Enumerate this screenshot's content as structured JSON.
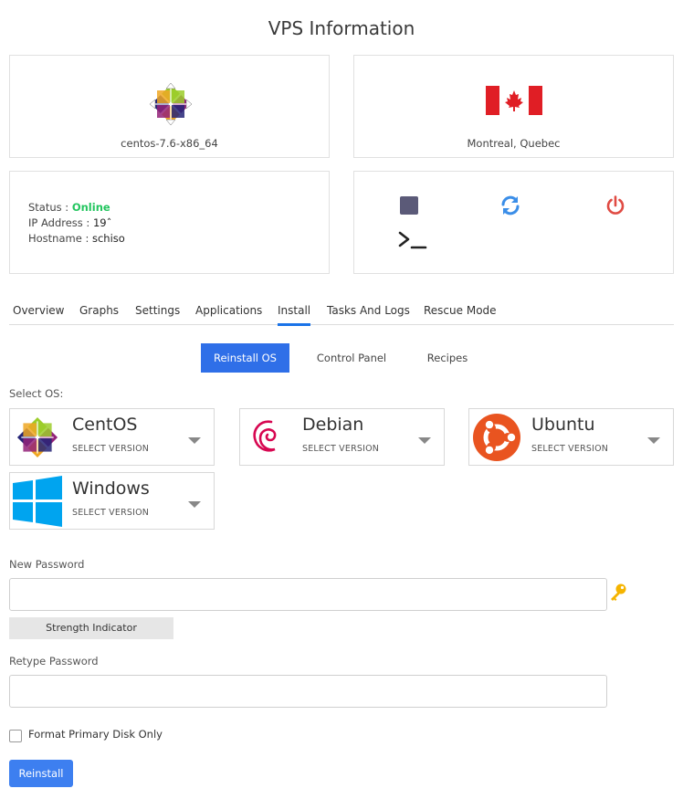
{
  "page": {
    "title": "VPS Information"
  },
  "os_card": {
    "name": "centos-7.6-x86_64",
    "logo": "centos-logo-icon"
  },
  "location_card": {
    "name": "Montreal, Quebec",
    "flag": "canada-flag-icon"
  },
  "info_card": {
    "status_label": "Status : ",
    "status_value": "Online",
    "ip_label": "IP Address : ",
    "ip_value": "19ˆ",
    "hostname_label": "Hostname : ",
    "hostname_value": "schiso"
  },
  "controls": [
    {
      "name": "stop-icon"
    },
    {
      "name": "restart-icon"
    },
    {
      "name": "power-icon"
    },
    {
      "name": "console-icon"
    }
  ],
  "tabs": [
    "Overview",
    "Graphs",
    "Settings",
    "Applications",
    "Install",
    "Tasks And Logs",
    "Rescue Mode"
  ],
  "active_tab": "Install",
  "subtabs": [
    "Reinstall OS",
    "Control Panel",
    "Recipes"
  ],
  "active_subtab": "Reinstall OS",
  "select_os_label": "Select OS:",
  "os_options": [
    {
      "name": "CentOS",
      "sub": "SELECT VERSION"
    },
    {
      "name": "Debian",
      "sub": "SELECT VERSION"
    },
    {
      "name": "Ubuntu",
      "sub": "SELECT VERSION"
    },
    {
      "name": "Windows",
      "sub": "SELECT VERSION"
    }
  ],
  "form": {
    "new_password_label": "New Password",
    "new_password_value": "",
    "strength_label": "Strength Indicator",
    "retype_password_label": "Retype Password",
    "retype_password_value": "",
    "format_label": "Format Primary Disk Only",
    "submit_label": "Reinstall"
  },
  "colors": {
    "accent": "#2f6fe8",
    "online": "#22c55e",
    "power": "#e04b43",
    "restart": "#3b8ee8",
    "stop": "#5b5a78"
  }
}
